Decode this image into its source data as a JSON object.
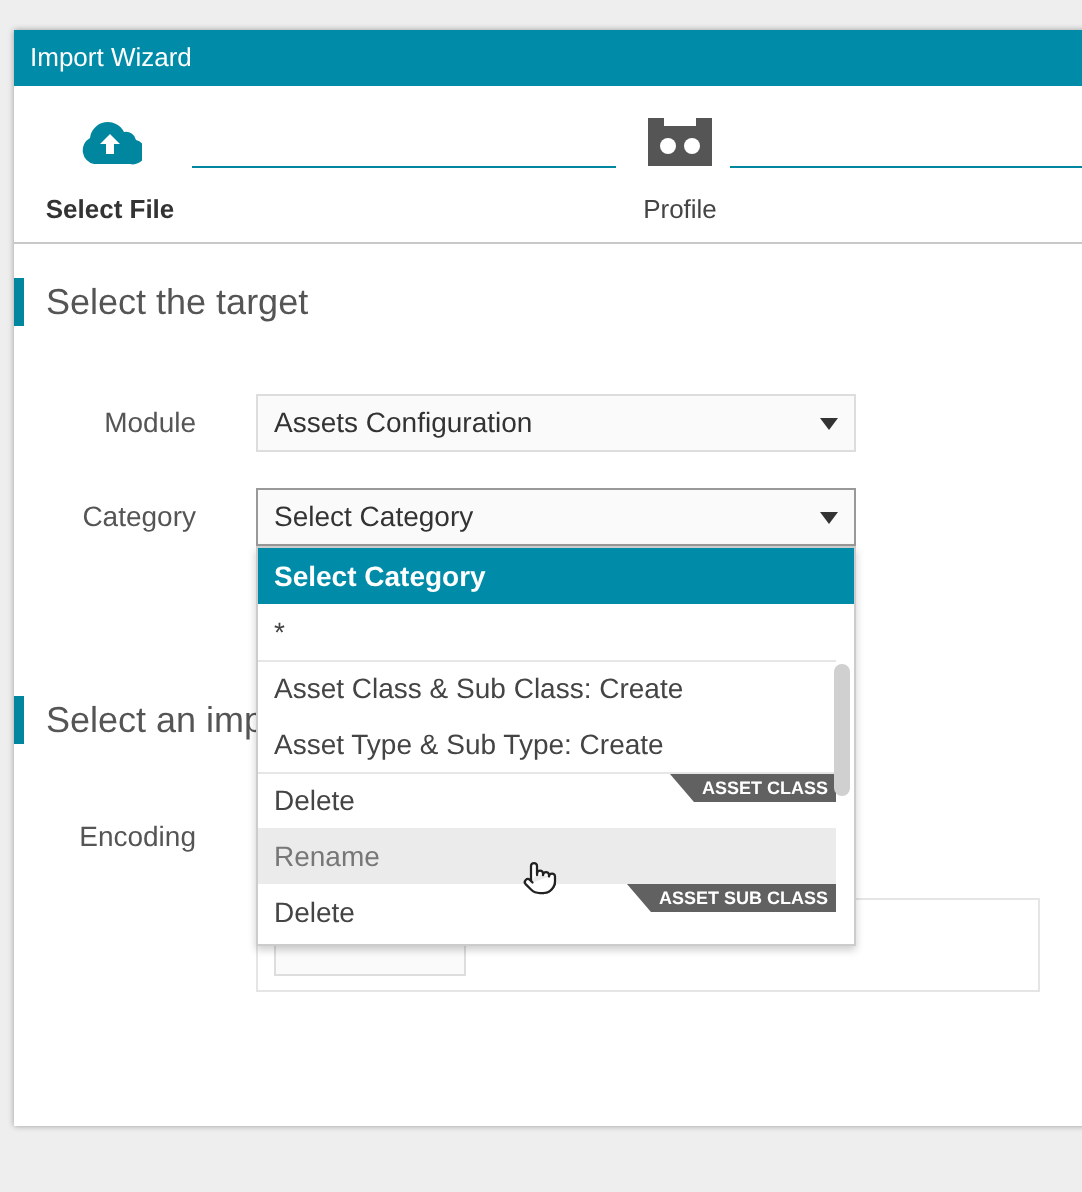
{
  "window": {
    "title": "Import Wizard"
  },
  "steps": [
    {
      "label": "Select File",
      "kind": "upload",
      "selected": true
    },
    {
      "label": "Profile",
      "kind": "profile",
      "selected": false
    }
  ],
  "target": {
    "title": "Select the target",
    "fields": [
      {
        "label": "Module",
        "value": "Assets Configuration",
        "focused": false
      },
      {
        "label": "Category",
        "value": "Select Category",
        "focused": true
      }
    ]
  },
  "dropdown": {
    "items": [
      {
        "label": "Select Category",
        "selected": true,
        "hovered": false,
        "divider": false
      },
      {
        "label": "*",
        "selected": false,
        "hovered": false,
        "divider": false
      },
      {
        "label": "Asset Class & Sub Class: Create",
        "selected": false,
        "hovered": false,
        "divider": true
      },
      {
        "label": "Asset Type & Sub Type: Create",
        "selected": false,
        "hovered": false,
        "divider": false
      },
      {
        "label": "Delete",
        "selected": false,
        "hovered": false,
        "divider": true,
        "group": "ASSET CLASS"
      },
      {
        "label": "Rename",
        "selected": false,
        "hovered": true,
        "divider": false
      },
      {
        "label": "Delete",
        "selected": false,
        "hovered": false,
        "divider": false,
        "group": "ASSET SUB CLASS"
      }
    ]
  },
  "import": {
    "title": "Select an imp",
    "fields": [
      {
        "label": "Encoding"
      }
    ]
  }
}
